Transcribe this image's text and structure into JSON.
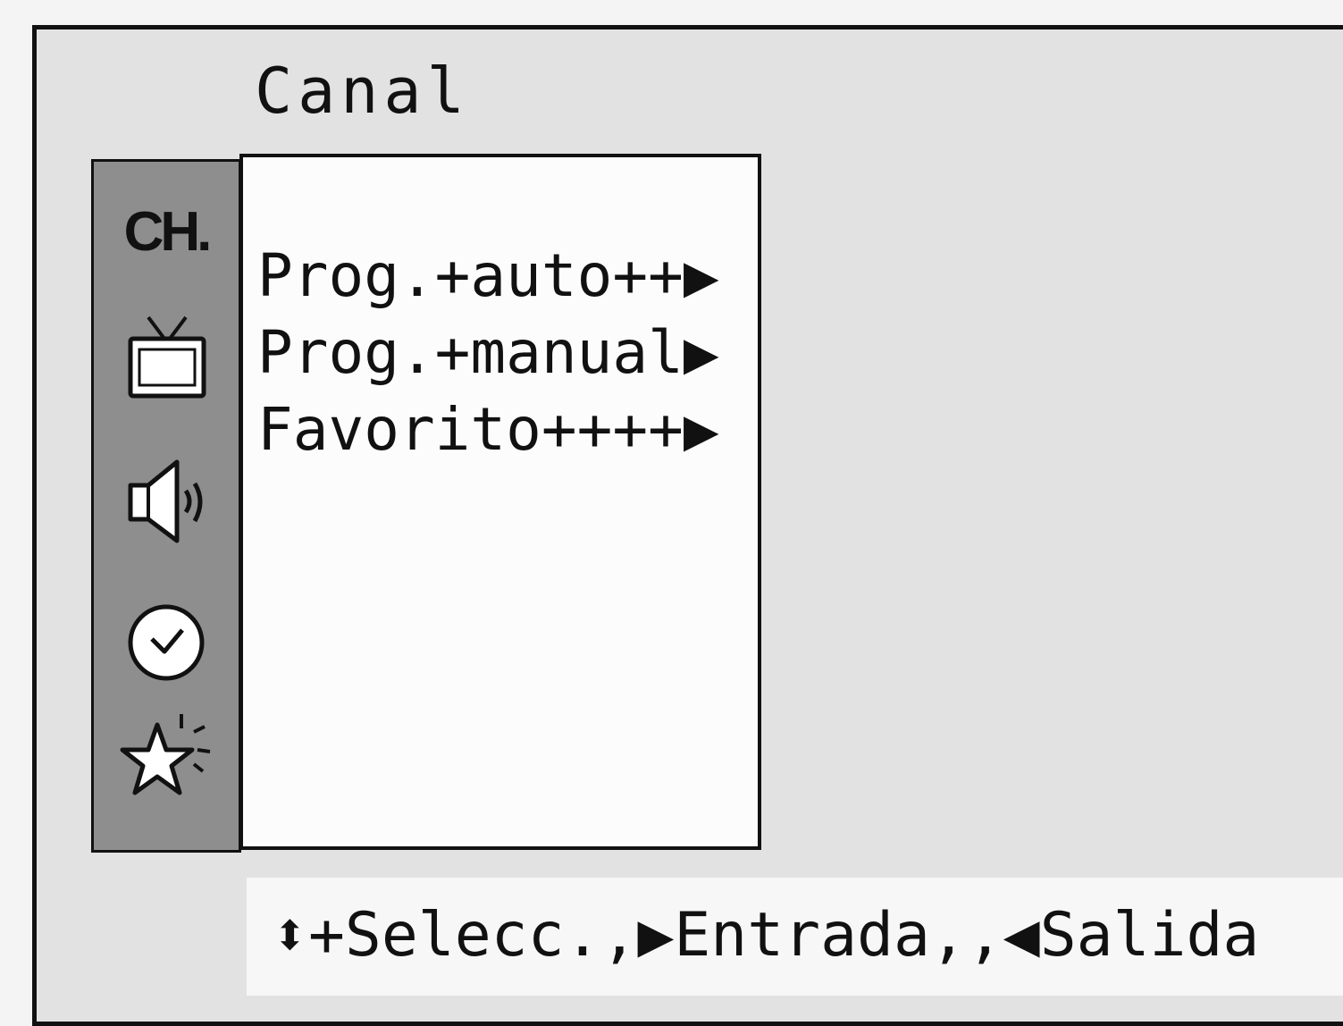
{
  "header": {
    "title": "Canal"
  },
  "sidebar": {
    "items": [
      {
        "label": "CH.",
        "icon": "channel-icon"
      },
      {
        "icon": "tv-icon"
      },
      {
        "icon": "speaker-icon"
      },
      {
        "icon": "clock-icon"
      },
      {
        "icon": "star-icon"
      }
    ]
  },
  "menu": {
    "items": [
      {
        "label": "Prog.+auto++▶"
      },
      {
        "label": "Prog.+manual▶"
      },
      {
        "label": "Favorito++++▶"
      }
    ]
  },
  "footer": {
    "help": "⬍+Selecc.,▶Entrada,,◀Salida"
  }
}
